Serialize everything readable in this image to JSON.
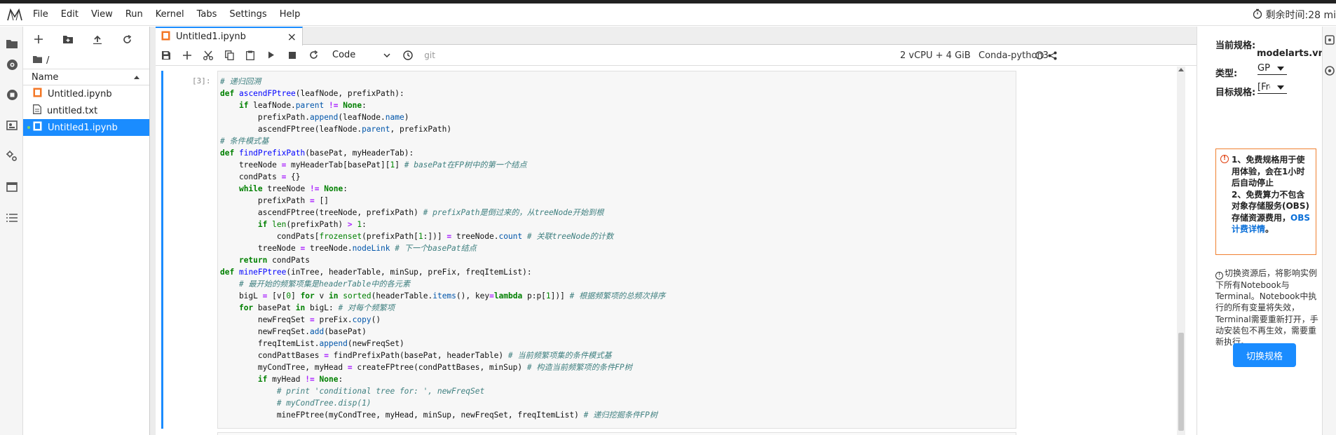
{
  "menubar": {
    "items": [
      "File",
      "Edit",
      "View",
      "Run",
      "Kernel",
      "Tabs",
      "Settings",
      "Help"
    ],
    "timer_text": "剩余时间:28 mi"
  },
  "filebrowser": {
    "path": "/",
    "column_name": "Name",
    "files": [
      {
        "name": "Untitled.ipynb",
        "type": "notebook"
      },
      {
        "name": "untitled.txt",
        "type": "text"
      },
      {
        "name": "Untitled1.ipynb",
        "type": "notebook",
        "selected": true
      }
    ]
  },
  "tab": {
    "title": "Untitled1.ipynb"
  },
  "toolbar": {
    "cell_type": "Code",
    "git_label": "git",
    "resources": "2 vCPU + 4 GiB",
    "kernel": "Conda-python3"
  },
  "cell": {
    "prompt": "[3]:",
    "code_lines": [
      "# 递归回溯",
      "def ascendFPtree(leafNode, prefixPath):",
      "    if leafNode.parent != None:",
      "        prefixPath.append(leafNode.name)",
      "        ascendFPtree(leafNode.parent, prefixPath)",
      "# 条件模式基",
      "def findPrefixPath(basePat, myHeaderTab):",
      "    treeNode = myHeaderTab[basePat][1] # basePat在FP树中的第一个结点",
      "    condPats = {}",
      "    while treeNode != None:",
      "        prefixPath = []",
      "        ascendFPtree(treeNode, prefixPath) # prefixPath是倒过来的，从treeNode开始到根",
      "        if len(prefixPath) > 1:",
      "            condPats[frozenset(prefixPath[1:])] = treeNode.count # 关联treeNode的计数",
      "        treeNode = treeNode.nodeLink # 下一个basePat结点",
      "    return condPats",
      "def mineFPtree(inTree, headerTable, minSup, preFix, freqItemList):",
      "    # 最开始的频繁项集是headerTable中的各元素",
      "    bigL = [v[0] for v in sorted(headerTable.items(), key=lambda p:p[1])] # 根据频繁项的总频次排序",
      "    for basePat in bigL: # 对每个频繁项",
      "        newFreqSet = preFix.copy()",
      "        newFreqSet.add(basePat)",
      "        freqItemList.append(newFreqSet)",
      "        condPattBases = findPrefixPath(basePat, headerTable) # 当前频繁项集的条件模式基",
      "        myCondTree, myHead = createFPtree(condPattBases, minSup) # 构造当前频繁项的条件FP树",
      "        if myHead != None:",
      "            # print 'conditional tree for: ', newFreqSet",
      "            # myCondTree.disp(1)",
      "            mineFPtree(myCondTree, myHead, minSup, newFreqSet, freqItemList) # 递归挖掘条件FP树"
    ]
  },
  "sidepanel": {
    "current_spec_label": "当前规格:",
    "current_spec_value": "modelarts.vm",
    "type_label": "类型:",
    "type_value": "GP",
    "target_label": "目标规格:",
    "target_value": "[Fre",
    "warning_text1": "1、免费规格用于使用体验，会在1小时后自动停止",
    "warning_text2": "2、免费算力不包含对象存储服务(OBS)存储资源费用，",
    "warning_link": "OBS计费详情",
    "warning_end": "。",
    "info_text": "切换资源后，将影响实例下所有Notebook与Terminal。Notebook中执行的所有变量将失效，Terminal需要重新打开，手动安装包不再生效，需要重新执行。",
    "switch_button": "切换规格"
  }
}
